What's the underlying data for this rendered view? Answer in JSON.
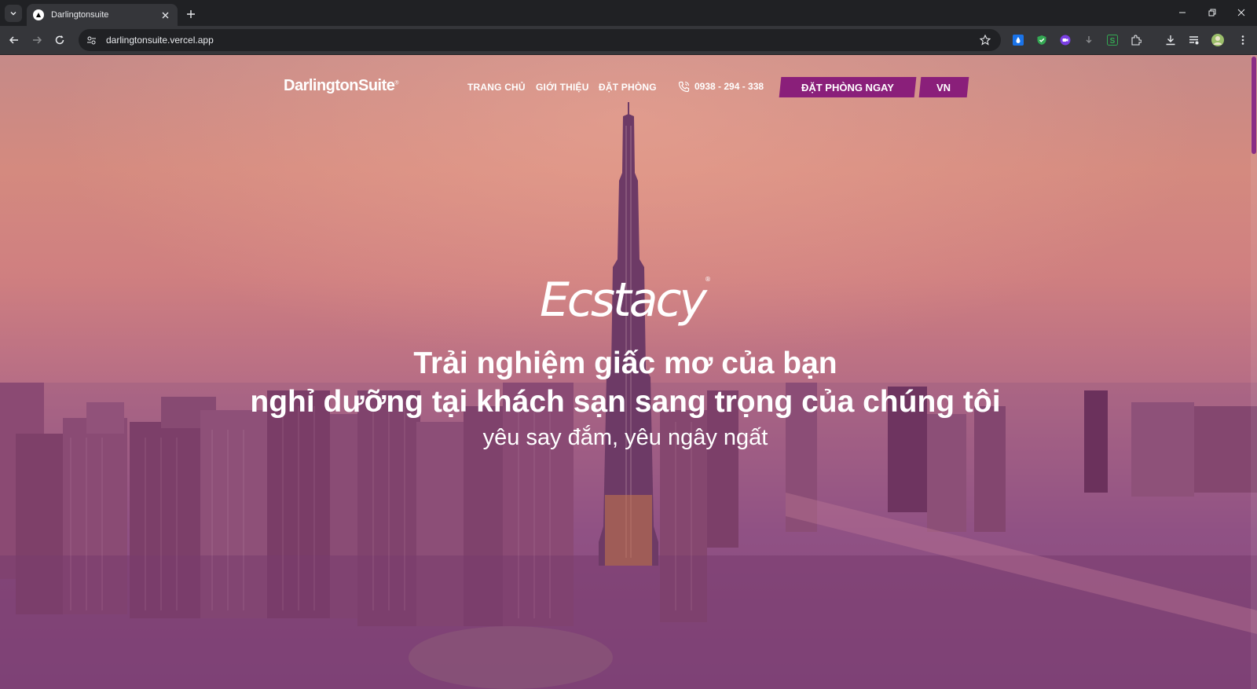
{
  "browser": {
    "tab_title": "Darlingtonsuite",
    "url": "darlingtonsuite.vercel.app",
    "icons": [
      "tab-search-icon",
      "favicon-icon",
      "close-icon",
      "plus-icon",
      "minimize-icon",
      "restore-icon",
      "window-close-icon",
      "back-icon",
      "forward-icon",
      "reload-icon",
      "site-info-icon",
      "star-icon",
      "extensions-icon",
      "downloads-icon",
      "reading-list-icon",
      "profile-avatar-icon",
      "menu-icon"
    ]
  },
  "site": {
    "logo": "DarlingtonSuite",
    "logo_mark": "®",
    "nav": {
      "home": "TRANG CHỦ",
      "about": "GIỚI THIỆU",
      "booking": "ĐẶT PHÒNG"
    },
    "phone": "0938 - 294 - 338",
    "book_now": "ĐẶT PHÒNG NGAY",
    "language": "VN",
    "brand_name": "Ecstacy",
    "brand_mark": "®",
    "headline_line1": "Trải nghiệm giấc mơ của bạn",
    "headline_line2": "nghỉ dưỡng tại khách sạn sang trọng của chúng tôi",
    "tagline": "yêu say đắm, yêu ngây ngất"
  },
  "colors": {
    "accent": "#8a1f7a",
    "chrome_dark": "#202124",
    "chrome_toolbar": "#35363a"
  }
}
